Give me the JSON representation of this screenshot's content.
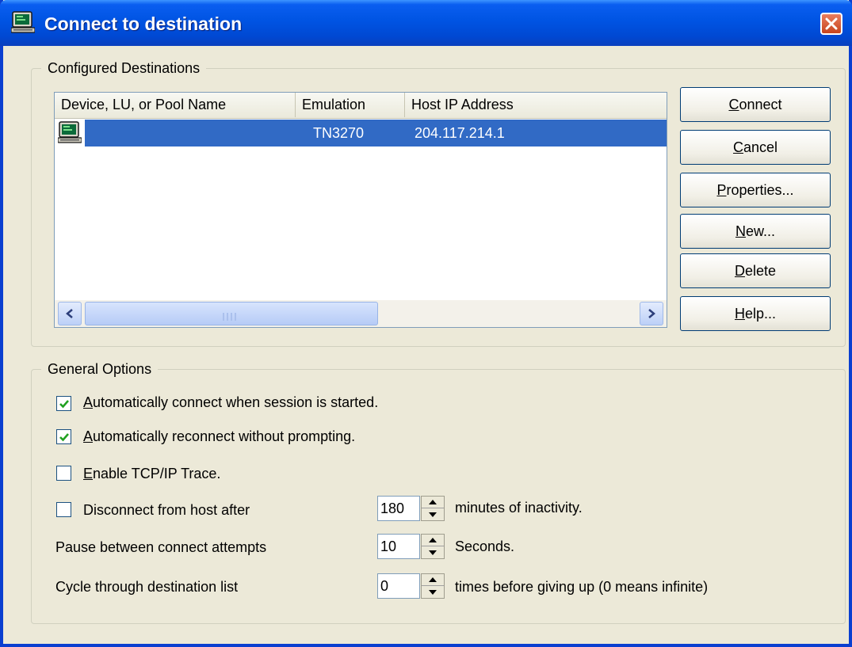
{
  "window": {
    "title": "Connect to destination"
  },
  "configured": {
    "legend": "Configured Destinations",
    "columns": [
      "Device, LU, or Pool Name",
      "Emulation",
      "Host IP Address"
    ],
    "rows": [
      {
        "name": "",
        "emulation": "TN3270",
        "host_ip": "204.117.214.1",
        "selected": true,
        "icon": "terminal-icon"
      }
    ]
  },
  "buttons": {
    "connect": {
      "accel": "C",
      "rest": "onnect"
    },
    "cancel": {
      "accel": "C",
      "rest": "ancel"
    },
    "properties": {
      "accel": "P",
      "rest": "roperties..."
    },
    "new": {
      "accel": "N",
      "rest": "ew..."
    },
    "delete": {
      "accel": "D",
      "rest": "elete"
    },
    "help": {
      "accel": "H",
      "rest": "elp..."
    }
  },
  "general": {
    "legend": "General Options",
    "auto_connect": {
      "accel": "A",
      "rest": "utomatically connect when session is started.",
      "checked": true
    },
    "auto_reconnect": {
      "accel": "A",
      "rest": "utomatically reconnect without prompting.",
      "checked": true
    },
    "tcp_trace": {
      "accel": "E",
      "rest": "nable TCP/IP Trace.",
      "checked": false
    },
    "disconnect": {
      "label": "Disconnect from host after",
      "checked": false,
      "value": "180",
      "suffix": "minutes of inactivity."
    },
    "pause": {
      "label": "Pause between connect attempts",
      "value": "10",
      "suffix": "Seconds."
    },
    "cycle": {
      "label": "Cycle through destination list",
      "value": "0",
      "suffix": "times before giving up (0 means infinite)"
    }
  },
  "colors": {
    "title_bar": "#0054e3",
    "selection": "#316ac5",
    "dialog_bg": "#ece9d8"
  }
}
